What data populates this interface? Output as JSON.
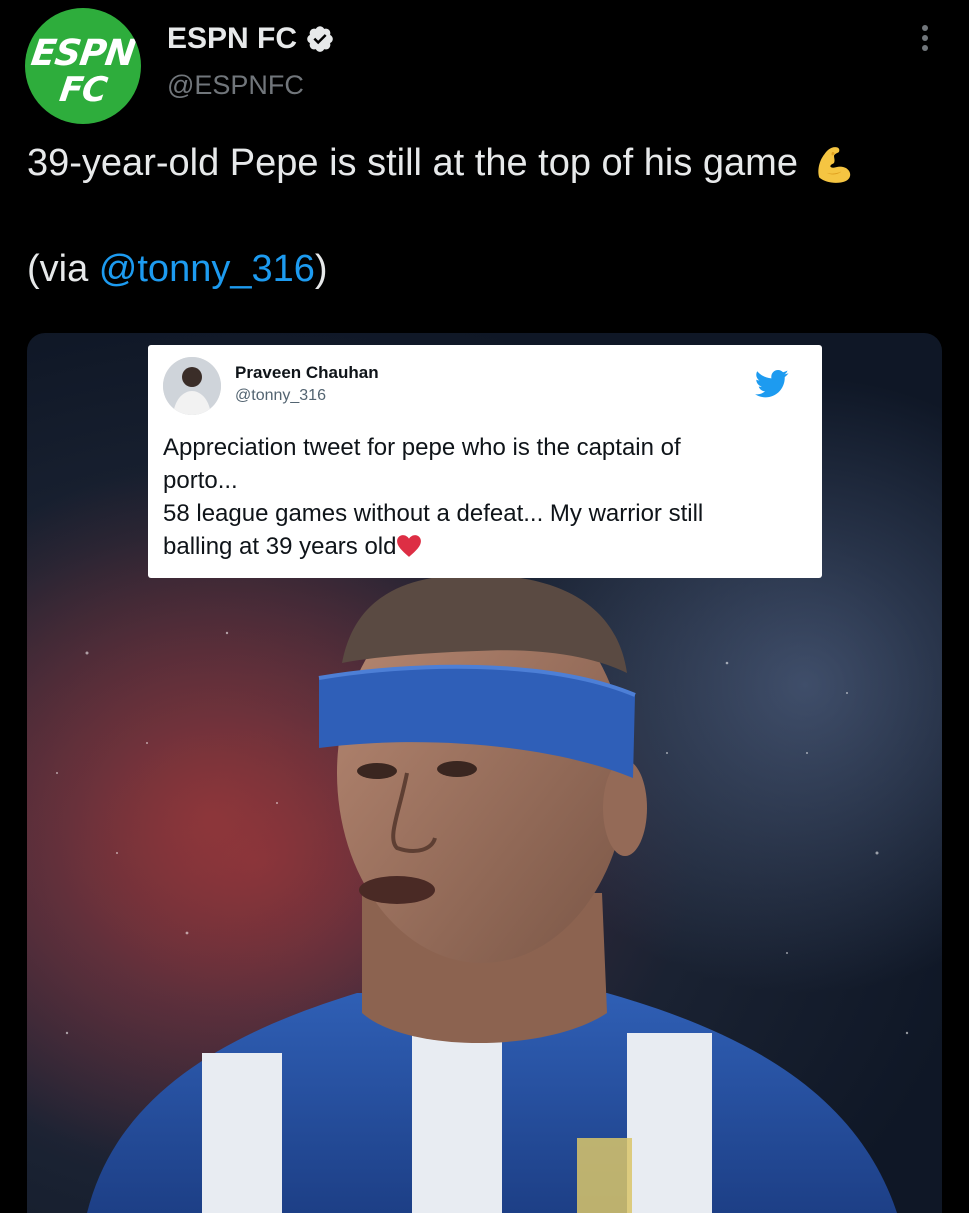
{
  "account": {
    "name": "ESPN FC",
    "handle": "@ESPNFC",
    "logo_line1": "ESPN",
    "logo_line2": "FC",
    "brand_color": "#2ead3c"
  },
  "tweet": {
    "text_line1": "39-year-old Pepe is still at the top of his game",
    "text_line1_emoji": "flexed-biceps-icon",
    "via_prefix": "(via ",
    "via_mention": "@tonny_316",
    "via_suffix": ")",
    "mention_color": "#1d9bf0"
  },
  "embedded_tweet": {
    "name": "Praveen Chauhan",
    "handle": "@tonny_316",
    "line1": "Appreciation tweet for pepe who is the captain of",
    "line2": "porto...",
    "line3": "58 league games without a defeat... My warrior still",
    "line4": "balling at 39 years old",
    "line4_emoji": "red-heart-icon",
    "bird_color": "#1d9bf0"
  },
  "icons": {
    "verified": "verified-badge-icon",
    "more": "more-options-icon"
  }
}
